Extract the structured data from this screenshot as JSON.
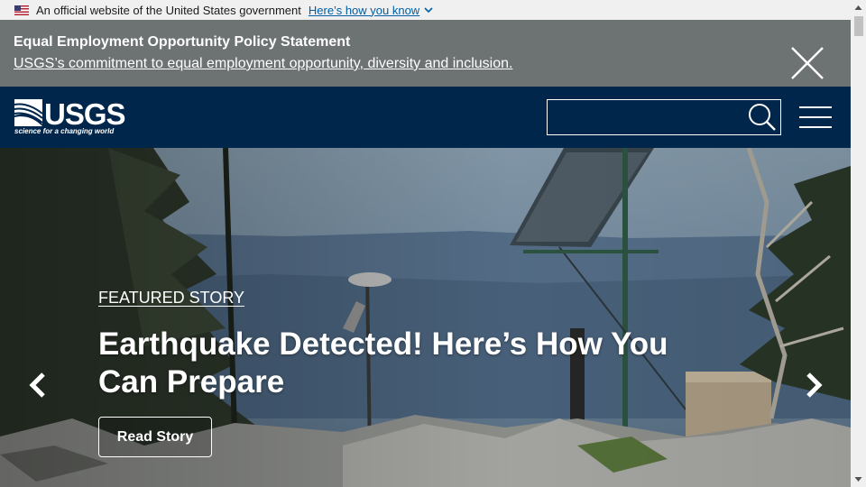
{
  "gov_banner": {
    "text": "An official website of the United States government",
    "link": "Here’s how you know"
  },
  "alert": {
    "title": "Equal Employment Opportunity Policy Statement",
    "link": "USGS’s commitment to equal employment opportunity, diversity and inclusion."
  },
  "header": {
    "logo_text": "USGS",
    "logo_tagline": "science for a changing world",
    "search_value": ""
  },
  "hero": {
    "eyebrow": "FEATURED STORY",
    "title": "Earthquake Detected! Here’s How You Can Prepare",
    "button": "Read Story"
  },
  "colors": {
    "banner_bg": "#f0f0f0",
    "alert_bg": "#6d7272",
    "header_bg": "#00264c",
    "link": "#005ea2"
  },
  "icons": [
    "us-flag-icon",
    "chevron-down-icon",
    "close-icon",
    "search-icon",
    "menu-icon",
    "chevron-left-icon",
    "chevron-right-icon"
  ]
}
